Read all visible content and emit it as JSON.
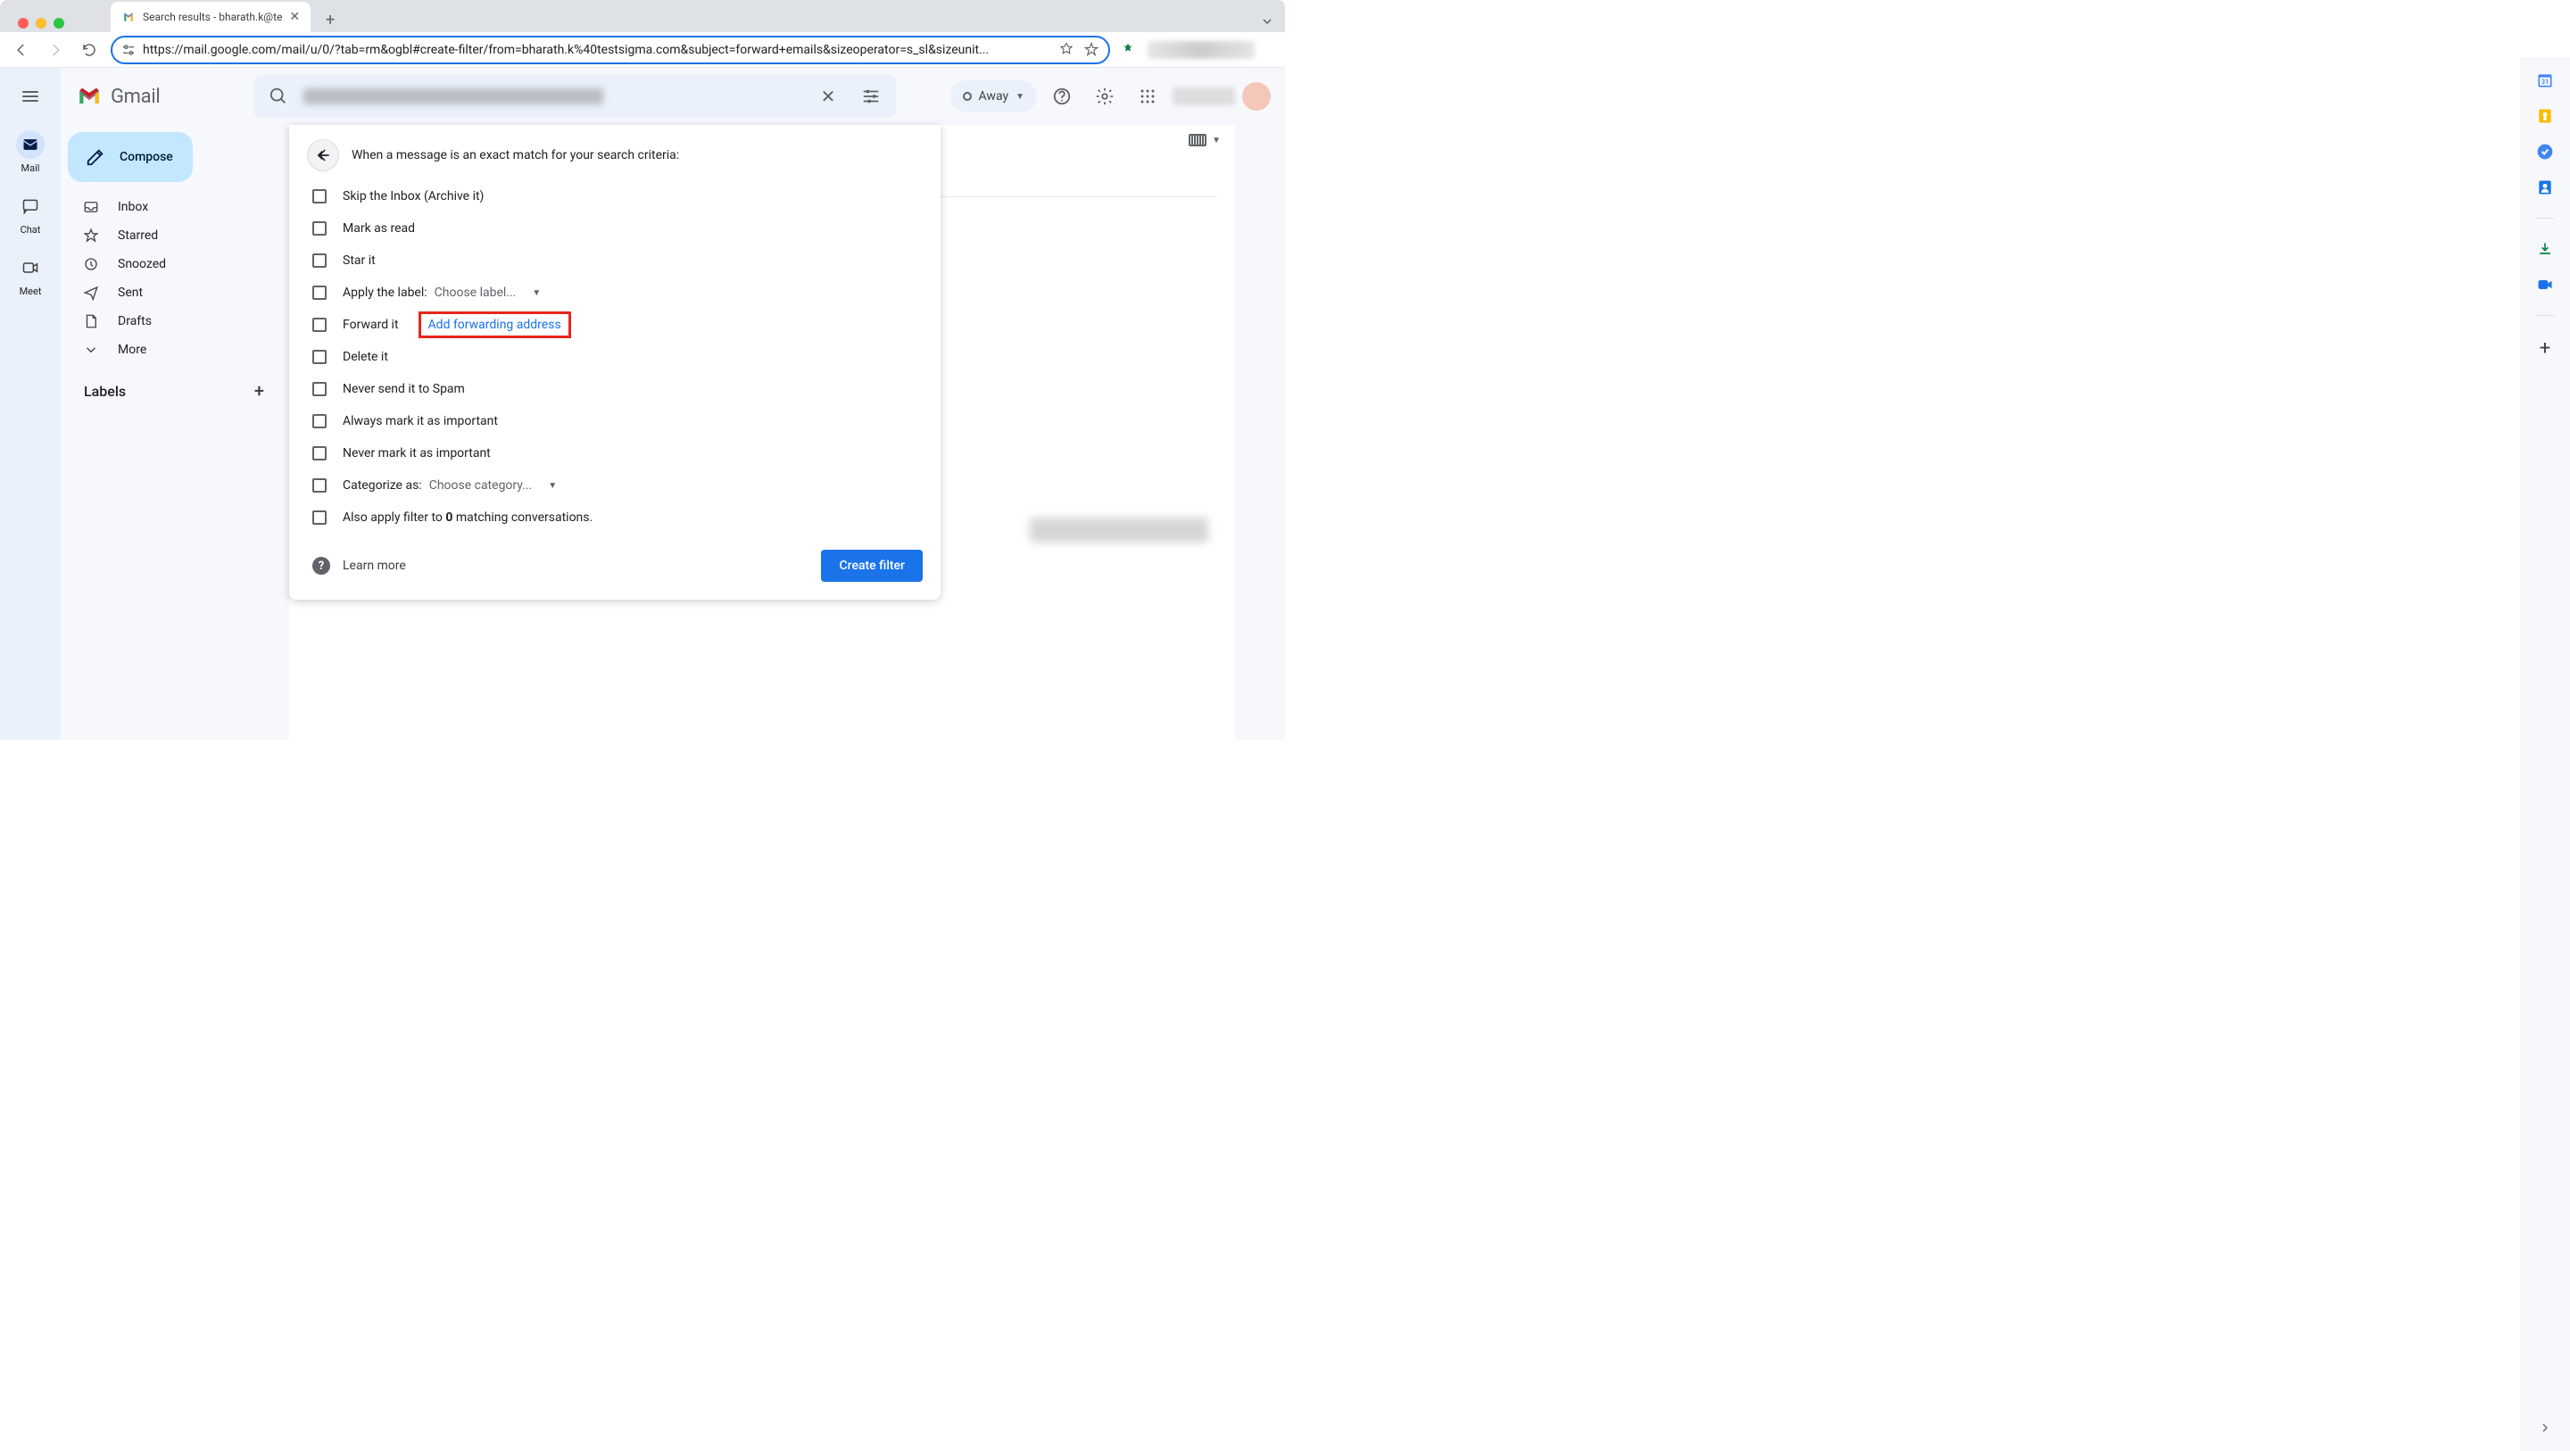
{
  "browser": {
    "tab_title": "Search results - bharath.k@te",
    "url": "https://mail.google.com/mail/u/0/?tab=rm&ogbl#create-filter/from=bharath.k%40testsigma.com&subject=forward+emails&sizeoperator=s_sl&sizeunit..."
  },
  "gmail": {
    "product_name": "Gmail",
    "compose": "Compose",
    "status": "Away",
    "rail": [
      {
        "label": "Mail"
      },
      {
        "label": "Chat"
      },
      {
        "label": "Meet"
      }
    ],
    "nav": [
      {
        "label": "Inbox"
      },
      {
        "label": "Starred"
      },
      {
        "label": "Snoozed"
      },
      {
        "label": "Sent"
      },
      {
        "label": "Drafts"
      },
      {
        "label": "More"
      }
    ],
    "labels_header": "Labels"
  },
  "filter": {
    "title": "When a message is an exact match for your search criteria:",
    "options": {
      "skip_inbox": "Skip the Inbox (Archive it)",
      "mark_read": "Mark as read",
      "star_it": "Star it",
      "apply_label": "Apply the label:",
      "choose_label": "Choose label...",
      "forward_it": "Forward it",
      "add_fwd_address": "Add forwarding address",
      "delete_it": "Delete it",
      "never_spam": "Never send it to Spam",
      "always_important": "Always mark it as important",
      "never_important": "Never mark it as important",
      "categorize_as": "Categorize as:",
      "choose_category": "Choose category...",
      "also_apply_pre": "Also apply filter to ",
      "also_apply_count": "0",
      "also_apply_post": " matching conversations."
    },
    "learn_more": "Learn more",
    "create_filter": "Create filter"
  }
}
